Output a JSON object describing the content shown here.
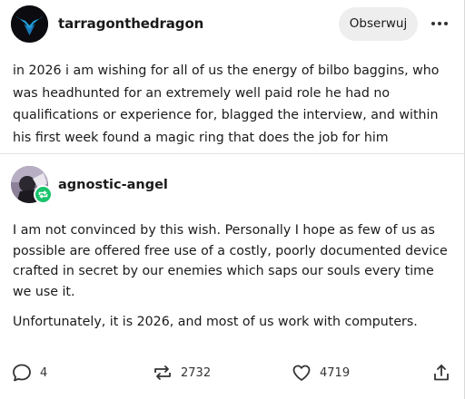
{
  "post": {
    "author": "tarragonthedragon",
    "follow_label": "Obserwuj",
    "more_label": "•••",
    "body": "in 2026 i am wishing for all of us the energy of bilbo baggins, who was headhunted for an extremely well paid role he had no qualifications or experience for, blagged the interview, and within his first week found a magic ring that does the job for him"
  },
  "reblog": {
    "author": "agnostic-angel",
    "paragraphs": [
      "I am not convinced by this wish. Personally I hope as few of us as possible are offered free use of a costly, poorly documented device crafted in secret by our enemies which saps our souls every time we use it.",
      "Unfortunately, it is 2026, and most of us work with computers."
    ]
  },
  "footer": {
    "replies": "4",
    "reblogs": "2732",
    "likes": "4719",
    "icons": {
      "reply": "speech-bubble-icon",
      "reblog": "reblog-arrows-icon",
      "like": "heart-icon",
      "share": "share-icon"
    }
  },
  "colors": {
    "text": "#1a1a1a",
    "follow_bg": "#eeeeee",
    "badge_green": "#19c46b",
    "nightwing_blue": "#1f9bd6"
  }
}
